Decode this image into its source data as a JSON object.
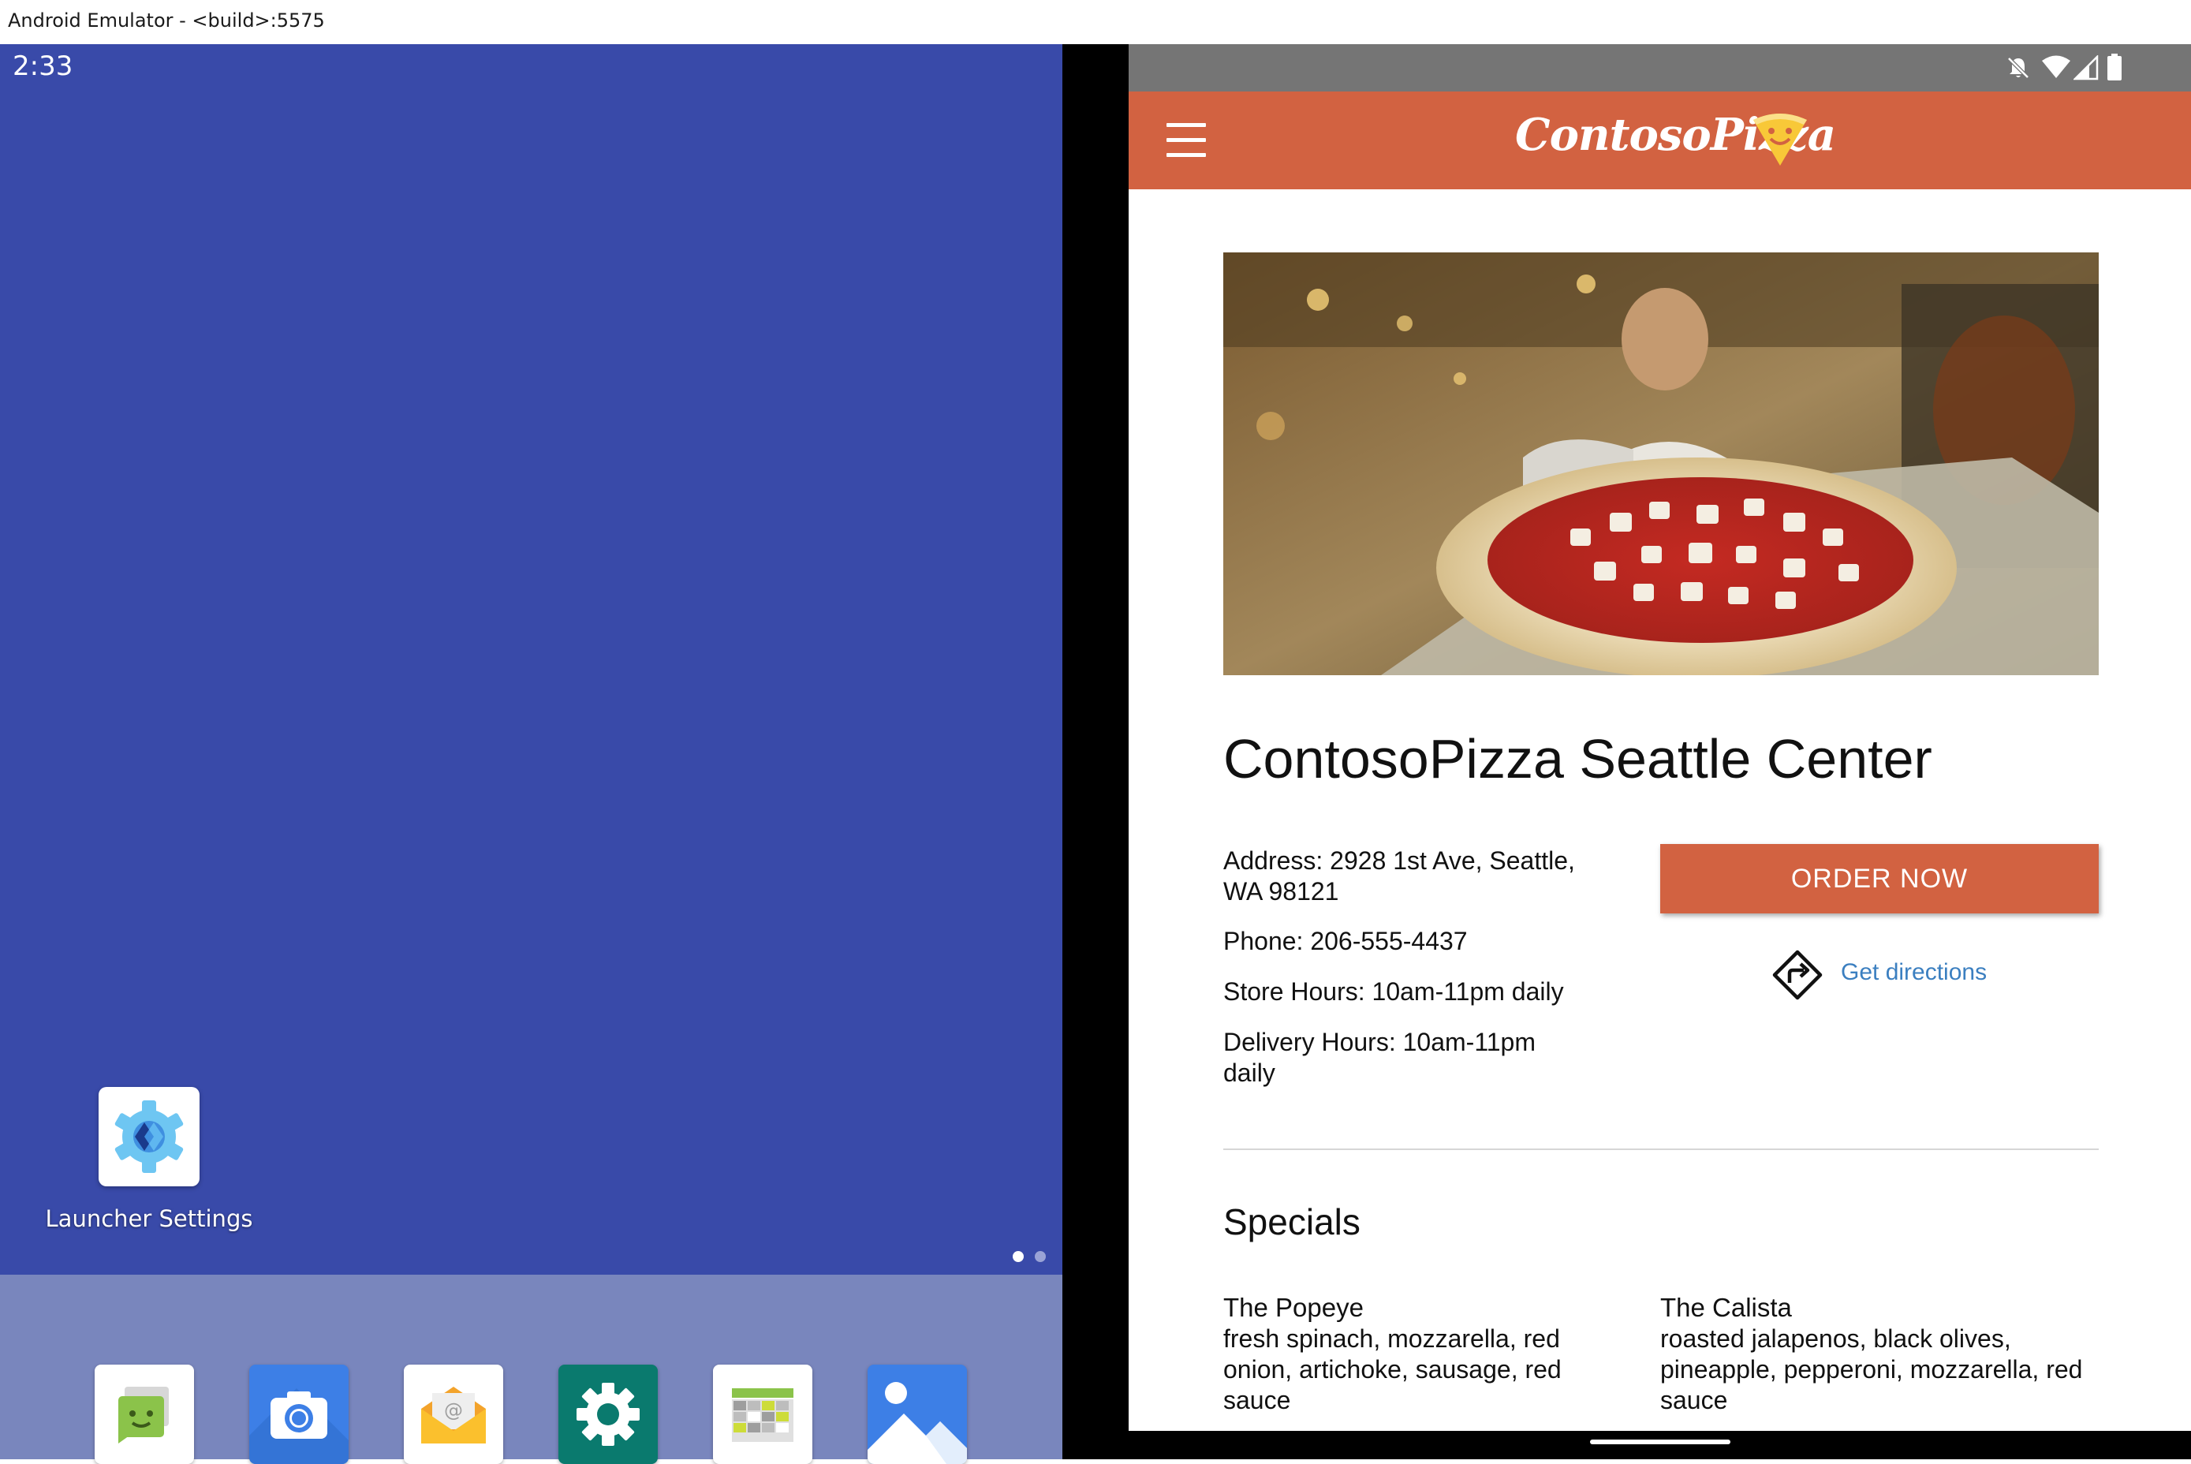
{
  "window": {
    "title": "Android Emulator - <build>:5575"
  },
  "left_screen": {
    "clock": "2:33",
    "launcher_settings_label": "Launcher Settings",
    "dock_apps": [
      {
        "name": "messages",
        "icon": "messages-icon",
        "color": "#ffffff"
      },
      {
        "name": "camera",
        "icon": "camera-icon",
        "color": "#3d7fe6"
      },
      {
        "name": "email",
        "icon": "email-icon",
        "color": "#ffffff"
      },
      {
        "name": "settings",
        "icon": "settings-icon",
        "color": "#0a7a6e"
      },
      {
        "name": "calendar",
        "icon": "calendar-icon",
        "color": "#ffffff"
      },
      {
        "name": "gallery",
        "icon": "gallery-icon",
        "color": "#3d7fe6"
      }
    ]
  },
  "right_screen": {
    "status_icons": [
      "notifications-off-icon",
      "wifi-icon",
      "signal-icon",
      "battery-icon"
    ],
    "app": {
      "brand": "ContosoPizza",
      "brand_color": "#d26241",
      "store_name": "ContosoPizza Seattle Center",
      "address": "Address: 2928 1st Ave, Seattle, WA 98121",
      "phone": "Phone: 206-555-4437",
      "store_hours": "Store Hours: 10am-11pm daily",
      "delivery_hours": "Delivery Hours: 10am-11pm daily",
      "order_button": "ORDER NOW",
      "directions_link": "Get directions",
      "link_color": "#3b7fc0",
      "specials_heading": "Specials",
      "specials": [
        {
          "name": "The Popeye",
          "description": "fresh spinach, mozzarella, red onion, artichoke, sausage, red sauce"
        },
        {
          "name": "The Calista",
          "description": "roasted jalapenos, black olives, pineapple, pepperoni, mozzarella, red sauce"
        }
      ]
    }
  }
}
